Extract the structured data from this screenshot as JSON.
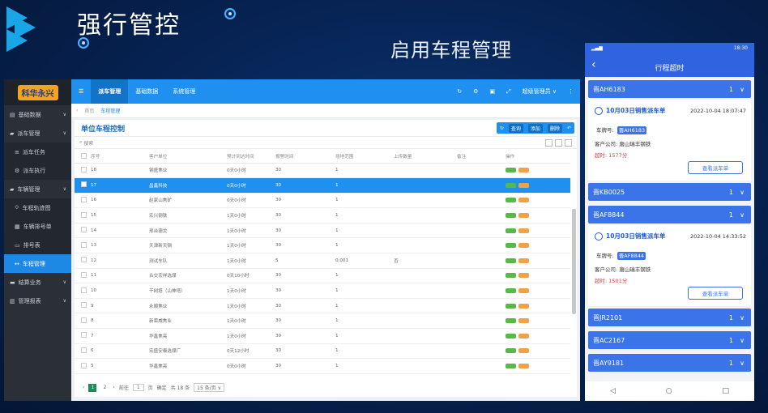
{
  "slide": {
    "title": "强行管控",
    "subtitle": "启用车程管理"
  },
  "desktop": {
    "logo": "科华永兴",
    "sidebar": [
      {
        "label": "基础数据",
        "icon": "database-icon",
        "sub": false,
        "active": false
      },
      {
        "label": "派车管理",
        "icon": "truck-icon",
        "sub": false,
        "active": false
      },
      {
        "label": "派车任务",
        "icon": "list-icon",
        "sub": true,
        "active": false
      },
      {
        "label": "派车执行",
        "icon": "gear-icon",
        "sub": true,
        "active": false
      },
      {
        "label": "车辆管理",
        "icon": "car-icon",
        "sub": false,
        "active": false
      },
      {
        "label": "车程轨迹图",
        "icon": "route-icon",
        "sub": true,
        "active": false
      },
      {
        "label": "车辆排号单",
        "icon": "ticket-icon",
        "sub": true,
        "active": false
      },
      {
        "label": "排号表",
        "icon": "monitor-icon",
        "sub": true,
        "active": false
      },
      {
        "label": "车程管理",
        "icon": "swap-icon",
        "sub": true,
        "active": true
      },
      {
        "label": "结算业务",
        "icon": "card-icon",
        "sub": false,
        "active": false
      },
      {
        "label": "管理报表",
        "icon": "chart-icon",
        "sub": false,
        "active": false
      }
    ],
    "topnav": {
      "menu": "☰",
      "tabs": [
        "派车管理",
        "基础数据",
        "系统管理"
      ],
      "user": "超级管理员 ∨"
    },
    "crumbs": {
      "home": "首页",
      "current": "车程管理"
    },
    "panel_title": "单位车程控制",
    "tools": {
      "query": "查询",
      "add": "添加",
      "delete": "删除"
    },
    "search_placeholder": "搜索",
    "columns": [
      "序号",
      "客户单位",
      "预计到达时间",
      "报警时间",
      "场地范围",
      "上传数量",
      "备注",
      "操作"
    ],
    "rows": [
      [
        "18",
        "钢盛焦业",
        "0天0小时",
        "30",
        "1",
        "",
        ""
      ],
      [
        "17",
        "昌鑫科技",
        "0天0小时",
        "30",
        "1",
        "",
        ""
      ],
      [
        "16",
        "赵家山焦矿",
        "0天0小时",
        "30",
        "1",
        "",
        ""
      ],
      [
        "15",
        "宏兴钢铁",
        "1天0小时",
        "30",
        "1",
        "",
        ""
      ],
      [
        "14",
        "邢台德龙",
        "1天0小时",
        "30",
        "1",
        "",
        ""
      ],
      [
        "13",
        "天津新天钢",
        "1天0小时",
        "30",
        "1",
        "",
        ""
      ],
      [
        "12",
        "测试车队",
        "1天0小时",
        "5",
        "0.001",
        "否",
        ""
      ],
      [
        "11",
        "古交宏祥选煤",
        "0天10小时",
        "30",
        "1",
        "",
        ""
      ],
      [
        "10",
        "干树塔（山神塔）",
        "1天0小时",
        "30",
        "1",
        "",
        ""
      ],
      [
        "9",
        "永顺焦业",
        "1天0小时",
        "30",
        "1",
        "",
        ""
      ],
      [
        "8",
        "新荣威焦业",
        "1天0小时",
        "30",
        "1",
        "",
        ""
      ],
      [
        "7",
        "华鑫焦亮",
        "1天0小时",
        "30",
        "1",
        "",
        ""
      ],
      [
        "6",
        "宏盛安泰选煤厂",
        "0天12小时",
        "30",
        "1",
        "",
        ""
      ],
      [
        "5",
        "华鑫焦亮",
        "0天0小时",
        "30",
        "1",
        "",
        ""
      ]
    ],
    "selected_row": 1,
    "pager": {
      "pages": [
        "1",
        "2"
      ],
      "goto": "前往",
      "page_input": "1",
      "page_unit": "页",
      "confirm": "确定",
      "total": "共 18 条",
      "per_page": "15 条/页 ∨"
    }
  },
  "mobile": {
    "time": "18:30",
    "title": "行程超时",
    "trips": [
      {
        "plate": "晋AH6183",
        "count": "1",
        "expanded": true,
        "task": "10月03日销售派车单",
        "datetime": "2022-10-04 18:07:47",
        "plate_label": "车牌号:",
        "company_label": "客户公司:",
        "company": "唐山瑞丰钢铁",
        "overtime_label": "超时:",
        "overtime": "1577分",
        "button": "查看派车单"
      },
      {
        "plate": "晋KB0025",
        "count": "1",
        "expanded": false
      },
      {
        "plate": "晋AF8844",
        "count": "1",
        "expanded": true,
        "task": "10月03日销售派车单",
        "datetime": "2022-10-04 14:33:52",
        "plate_label": "车牌号:",
        "company_label": "客户公司:",
        "company": "唐山瑞丰钢铁",
        "overtime_label": "超时:",
        "overtime": "1501分",
        "button": "查看派车单"
      },
      {
        "plate": "晋JR2101",
        "count": "1",
        "expanded": false
      },
      {
        "plate": "晋AC2167",
        "count": "1",
        "expanded": false
      },
      {
        "plate": "晋AY9181",
        "count": "1",
        "expanded": false
      }
    ],
    "nav": [
      "◁",
      "○",
      "□"
    ]
  }
}
